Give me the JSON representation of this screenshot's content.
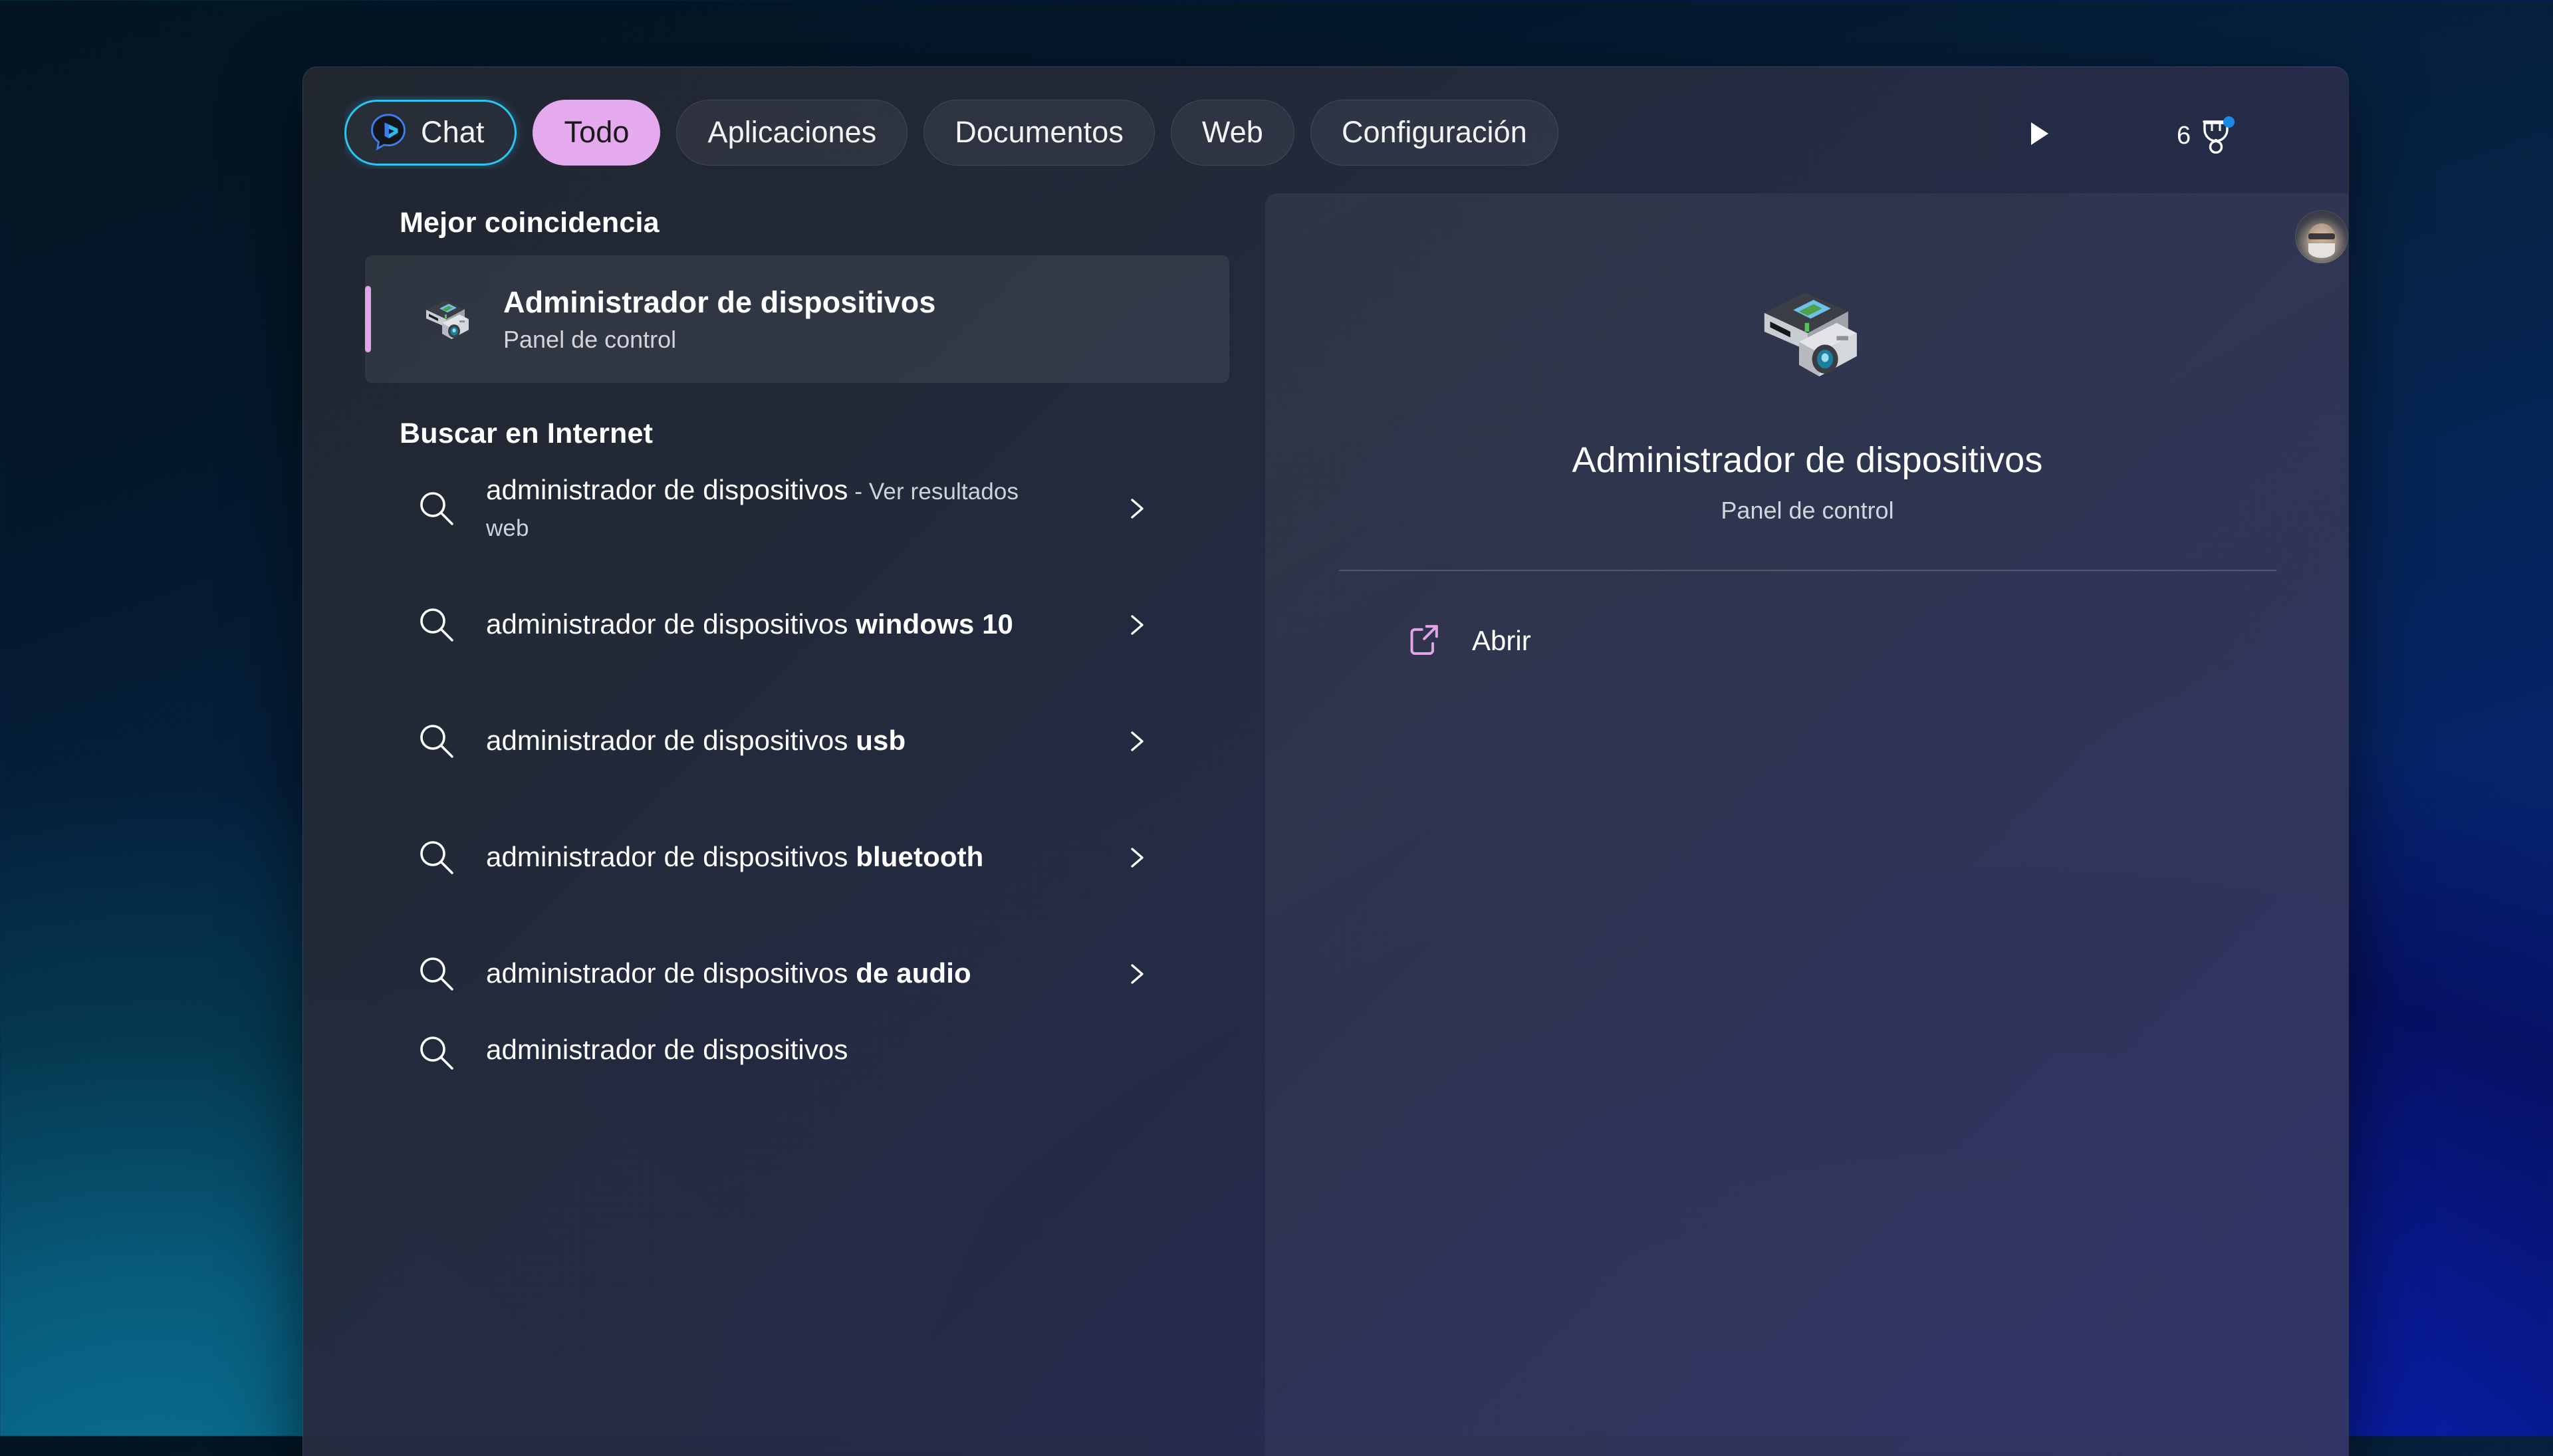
{
  "window": {
    "title": "Windows Search",
    "accent_pink": "#e2a3e8",
    "accent_cyan": "#2ec4f0",
    "chip_active_bg": "#e5a9ee"
  },
  "tabbar": {
    "chat_tab": {
      "label": "Chat",
      "icon": "bing-chat-icon"
    },
    "tabs": [
      {
        "label": "Todo",
        "active": true
      },
      {
        "label": "Aplicaciones",
        "active": false
      },
      {
        "label": "Documentos",
        "active": false
      },
      {
        "label": "Web",
        "active": false
      },
      {
        "label": "Configuración",
        "active": false
      }
    ],
    "scroll_right_icon": "play-triangle-icon",
    "rewards": {
      "count": "6",
      "icon": "medal-icon",
      "badge": true
    },
    "avatar": {
      "icon": "user-avatar"
    },
    "more_icon": "more-ellipsis-icon",
    "bing_logo_icon": "bing-logo-icon"
  },
  "results": {
    "best_match_heading": "Mejor coincidencia",
    "best_match": {
      "title": "Administrador de dispositivos",
      "subtitle": "Panel de control",
      "icon": "device-manager-icon",
      "selected": true
    },
    "web_heading": "Buscar en Internet",
    "web_items": [
      {
        "base": "administrador de dispositivos",
        "bold": "",
        "suffix": " - Ver resultados web",
        "icon": "search-icon",
        "chevron": "chevron-right-icon"
      },
      {
        "base": "administrador de dispositivos ",
        "bold": "windows 10",
        "suffix": "",
        "icon": "search-icon",
        "chevron": "chevron-right-icon"
      },
      {
        "base": "administrador de dispositivos ",
        "bold": "usb",
        "suffix": "",
        "icon": "search-icon",
        "chevron": "chevron-right-icon"
      },
      {
        "base": "administrador de dispositivos ",
        "bold": "bluetooth",
        "suffix": "",
        "icon": "search-icon",
        "chevron": "chevron-right-icon"
      },
      {
        "base": "administrador de dispositivos ",
        "bold": "de audio",
        "suffix": "",
        "icon": "search-icon",
        "chevron": "chevron-right-icon"
      },
      {
        "base": "administrador de dispositivos",
        "bold": "",
        "suffix": "",
        "icon": "search-icon",
        "chevron": "chevron-right-icon"
      }
    ]
  },
  "preview": {
    "icon": "device-manager-icon",
    "title": "Administrador de dispositivos",
    "subtitle": "Panel de control",
    "open_action": {
      "label": "Abrir",
      "icon": "open-external-icon"
    }
  }
}
